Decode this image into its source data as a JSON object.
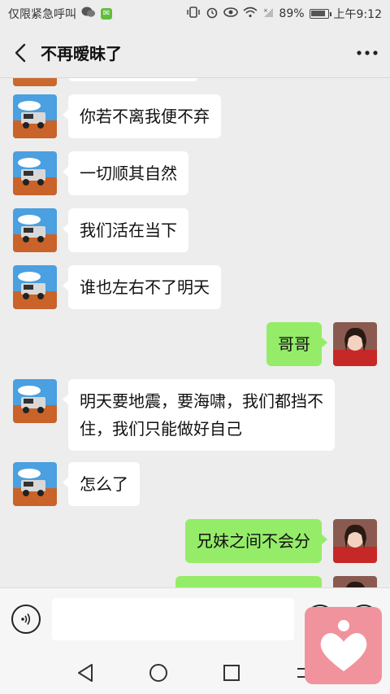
{
  "status_bar": {
    "left_text": "仅限紧急呼叫",
    "icons_left": [
      "wechat-icon",
      "sms-icon"
    ],
    "icons_right": [
      "vibrate-icon",
      "alarm-icon",
      "eye-icon",
      "wifi-icon",
      "signal-x-icon"
    ],
    "battery_percent": "89%",
    "battery_level": 0.89,
    "time": "上午9:12"
  },
  "header": {
    "title": "不再暧昧了"
  },
  "messages": [
    {
      "side": "left",
      "text": "你若不离我便不弃"
    },
    {
      "side": "left",
      "text": "一切顺其自然"
    },
    {
      "side": "left",
      "text": "我们活在当下"
    },
    {
      "side": "left",
      "text": "谁也左右不了明天"
    },
    {
      "side": "right",
      "text": "哥哥"
    },
    {
      "side": "left",
      "text": "明天要地震，要海啸，我们都挡不住，我们只能做好自己"
    },
    {
      "side": "left",
      "text": "怎么了"
    },
    {
      "side": "right",
      "text": "兄妹之间不会分"
    }
  ],
  "input": {
    "value": "",
    "placeholder": ""
  },
  "colors": {
    "background": "#ededed",
    "bubble_self": "#95ec69",
    "bubble_other": "#ffffff",
    "floating_app": "#f1939c"
  }
}
